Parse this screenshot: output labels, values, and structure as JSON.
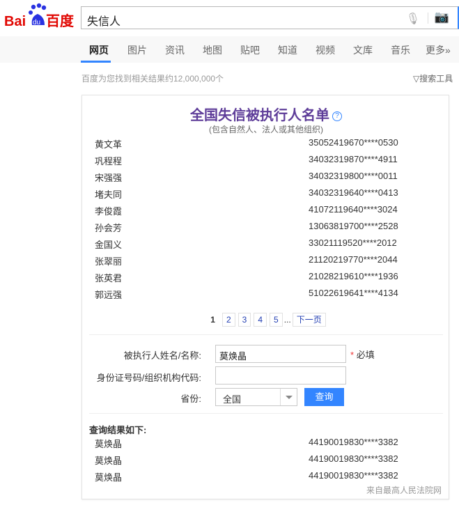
{
  "header": {
    "logo_text": "Bai du 百度",
    "query": "失信人",
    "mic_icon": "microphone-icon",
    "camera_icon": "camera-icon"
  },
  "nav": {
    "tabs": [
      "网页",
      "图片",
      "资讯",
      "地图",
      "贴吧",
      "知道",
      "视频",
      "文库",
      "音乐",
      "更多»"
    ],
    "active": 0
  },
  "results_count": "百度为您找到相关结果约12,000,000个",
  "search_tools": "搜索工具",
  "card": {
    "title": "全国失信被执行人名单",
    "subtitle": "(包含自然人、法人或其他组织)",
    "list": [
      {
        "name": "黄文革",
        "id": "35052419670****0530"
      },
      {
        "name": "巩程程",
        "id": "34032319870****4911"
      },
      {
        "name": "宋强强",
        "id": "34032319800****0011"
      },
      {
        "name": "堵夫同",
        "id": "34032319640****0413"
      },
      {
        "name": "李俊霞",
        "id": "41072119640****3024"
      },
      {
        "name": "孙会芳",
        "id": "13063819700****2528"
      },
      {
        "name": "金国义",
        "id": "33021119520****2012"
      },
      {
        "name": "张翠丽",
        "id": "21120219770****2044"
      },
      {
        "name": "张英君",
        "id": "21028219610****1936"
      },
      {
        "name": "郭远强",
        "id": "51022619641****4134"
      }
    ],
    "pager": {
      "current": "1",
      "pages": [
        "2",
        "3",
        "4",
        "5"
      ],
      "ellipsis": "...",
      "next": "下一页"
    },
    "form": {
      "name_label": "被执行人姓名/名称:",
      "name_value": "莫焕晶",
      "required_mark": "*",
      "required_text": "必填",
      "id_label": "身份证号码/组织机构代码:",
      "id_value": "",
      "province_label": "省份:",
      "province_value": "全国",
      "submit": "查询"
    },
    "results_label": "查询结果如下:",
    "results": [
      {
        "name": "莫焕晶",
        "id": "44190019830****3382"
      },
      {
        "name": "莫焕晶",
        "id": "44190019830****3382"
      },
      {
        "name": "莫焕晶",
        "id": "44190019830****3382"
      }
    ],
    "source": "来自最高人民法院网"
  }
}
